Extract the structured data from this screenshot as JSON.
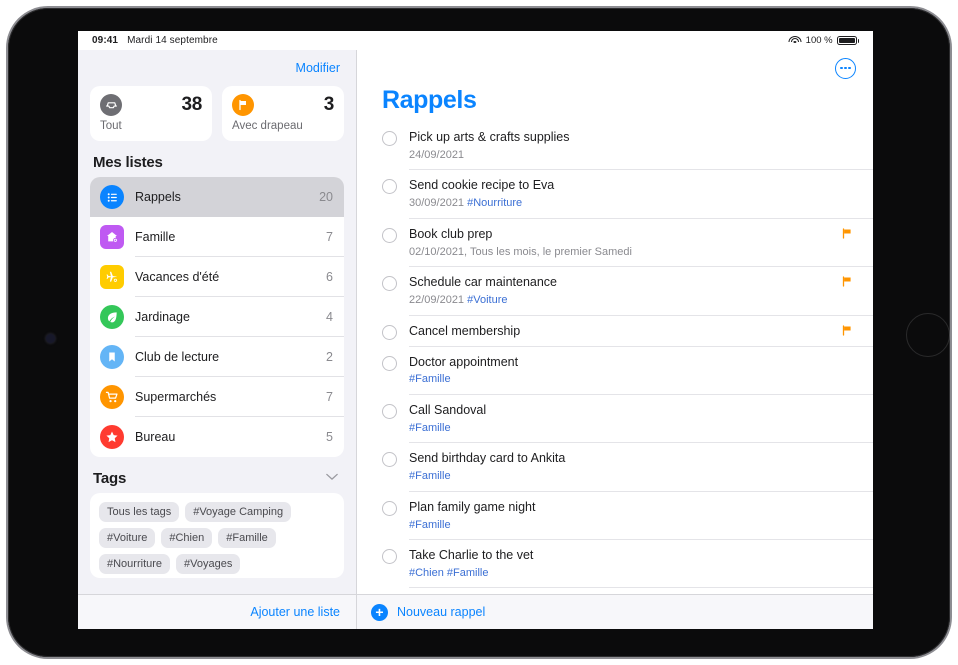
{
  "status_bar": {
    "time": "09:41",
    "date": "Mardi 14 septembre",
    "battery_percent": "100 %",
    "wifi_icon": "wifi-icon",
    "battery_icon": "battery-icon"
  },
  "sidebar": {
    "edit_label": "Modifier",
    "add_list_label": "Ajouter une liste",
    "smart_lists": [
      {
        "icon": "inbox-icon",
        "label": "Tout",
        "count": "38",
        "color": "#6e6e73"
      },
      {
        "icon": "flag-icon",
        "label": "Avec drapeau",
        "count": "3",
        "color": "#ff9500"
      }
    ],
    "my_lists_header": "Mes listes",
    "lists": [
      {
        "icon": "list-bullet-icon",
        "name": "Rappels",
        "count": "20",
        "color": "#0a84ff",
        "shape": "circle",
        "selected": true
      },
      {
        "icon": "house-icon",
        "name": "Famille",
        "count": "7",
        "color": "#bf5af2",
        "shape": "square",
        "selected": false
      },
      {
        "icon": "airplane-icon",
        "name": "Vacances d'été",
        "count": "6",
        "color": "#ffcc00",
        "shape": "square",
        "selected": false
      },
      {
        "icon": "leaf-icon",
        "name": "Jardinage",
        "count": "4",
        "color": "#34c759",
        "shape": "circle",
        "selected": false
      },
      {
        "icon": "bookmark-icon",
        "name": "Club de lecture",
        "count": "2",
        "color": "#64b5f6",
        "shape": "circle",
        "selected": false
      },
      {
        "icon": "cart-icon",
        "name": "Supermarchés",
        "count": "7",
        "color": "#ff9500",
        "shape": "circle",
        "selected": false
      },
      {
        "icon": "star-icon",
        "name": "Bureau",
        "count": "5",
        "color": "#ff3b30",
        "shape": "circle",
        "selected": false
      }
    ],
    "tags_header": "Tags",
    "tags_chevron_icon": "chevron-down-icon",
    "tags": [
      "Tous les tags",
      "#Voyage Camping",
      "#Voiture",
      "#Chien",
      "#Famille",
      "#Nourriture",
      "#Voyages"
    ]
  },
  "detail": {
    "title": "Rappels",
    "more_icon": "ellipsis-circle-icon",
    "new_reminder_label": "Nouveau rappel",
    "new_reminder_icon": "plus-circle-icon",
    "accent_color": "#0a84ff",
    "flag_color": "#ff9500",
    "reminders": [
      {
        "title": "Pick up arts & crafts supplies",
        "date": "24/09/2021",
        "tags": "",
        "flagged": false
      },
      {
        "title": "Send cookie recipe to Eva",
        "date": "30/09/2021",
        "tags": "#Nourriture",
        "flagged": false
      },
      {
        "title": "Book club prep",
        "date": "02/10/2021, Tous les mois, le premier Samedi",
        "tags": "",
        "flagged": true
      },
      {
        "title": "Schedule car maintenance",
        "date": "22/09/2021",
        "tags": "#Voiture",
        "flagged": true
      },
      {
        "title": "Cancel membership",
        "date": "",
        "tags": "",
        "flagged": true
      },
      {
        "title": "Doctor appointment",
        "date": "",
        "tags": "#Famille",
        "flagged": false
      },
      {
        "title": "Call Sandoval",
        "date": "",
        "tags": "#Famille",
        "flagged": false
      },
      {
        "title": "Send birthday card to Ankita",
        "date": "",
        "tags": "#Famille",
        "flagged": false
      },
      {
        "title": "Plan family game night",
        "date": "",
        "tags": "#Famille",
        "flagged": false
      },
      {
        "title": "Take Charlie to the vet",
        "date": "",
        "tags": "#Chien #Famille",
        "flagged": false
      }
    ]
  }
}
